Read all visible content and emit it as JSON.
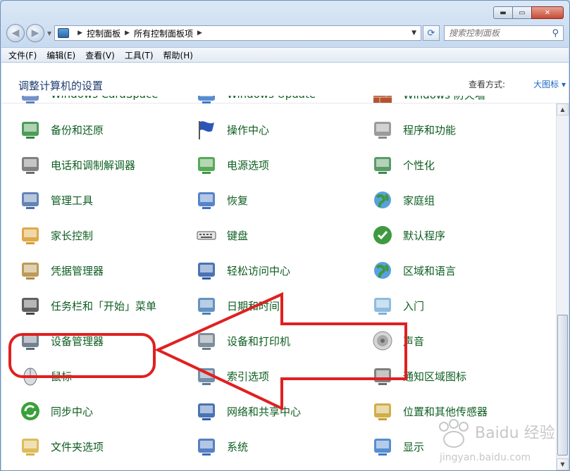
{
  "window": {
    "caption_buttons": {
      "minimize": "▬",
      "maximize": "▭",
      "close": "✕"
    }
  },
  "nav": {
    "back_icon": "◀",
    "forward_icon": "▶",
    "dropdown_icon": "▼",
    "breadcrumb": [
      "控制面板",
      "所有控制面板项"
    ],
    "refresh_icon": "⟳",
    "search_placeholder": "搜索控制面板",
    "search_icon": "⚲"
  },
  "menu": [
    "文件(F)",
    "编辑(E)",
    "查看(V)",
    "工具(T)",
    "帮助(H)"
  ],
  "header": {
    "title": "调整计算机的设置",
    "view_by_label": "查看方式:",
    "view_by_value": "大图标 ▾"
  },
  "items": [
    {
      "label": "Windows CardSpace",
      "icon": "cardspace-icon",
      "color": "#5b7fc0"
    },
    {
      "label": "Windows Update",
      "icon": "windows-update-icon",
      "color": "#3a78c8"
    },
    {
      "label": "Windows 防火墙",
      "icon": "firewall-icon",
      "color": "#b5532e"
    },
    {
      "label": "备份和还原",
      "icon": "backup-restore-icon",
      "color": "#2e8a3a"
    },
    {
      "label": "操作中心",
      "icon": "action-center-flag-icon",
      "color": "#2d55b8"
    },
    {
      "label": "程序和功能",
      "icon": "programs-features-icon",
      "color": "#8a8a8a"
    },
    {
      "label": "电话和调制解调器",
      "icon": "phone-modem-icon",
      "color": "#6b6b6b"
    },
    {
      "label": "电源选项",
      "icon": "power-options-icon",
      "color": "#3a9a3a"
    },
    {
      "label": "个性化",
      "icon": "personalization-icon",
      "color": "#3d8a4a"
    },
    {
      "label": "管理工具",
      "icon": "admin-tools-icon",
      "color": "#4a6ea8"
    },
    {
      "label": "恢复",
      "icon": "recovery-icon",
      "color": "#3a6fc0"
    },
    {
      "label": "家庭组",
      "icon": "homegroup-icon",
      "color": "#2f7fc9"
    },
    {
      "label": "家长控制",
      "icon": "parental-controls-icon",
      "color": "#d89a2a"
    },
    {
      "label": "键盘",
      "icon": "keyboard-icon",
      "color": "#555555"
    },
    {
      "label": "默认程序",
      "icon": "default-programs-icon",
      "color": "#3f9a3f"
    },
    {
      "label": "凭据管理器",
      "icon": "credential-manager-icon",
      "color": "#b0883a"
    },
    {
      "label": "轻松访问中心",
      "icon": "ease-of-access-icon",
      "color": "#2a5aa8"
    },
    {
      "label": "区域和语言",
      "icon": "region-language-icon",
      "color": "#2f8a4a"
    },
    {
      "label": "任务栏和「开始」菜单",
      "icon": "taskbar-start-menu-icon",
      "color": "#444444"
    },
    {
      "label": "日期和时间",
      "icon": "date-time-icon",
      "color": "#4a7fb8"
    },
    {
      "label": "入门",
      "icon": "getting-started-icon",
      "color": "#7ab0d8"
    },
    {
      "label": "设备管理器",
      "icon": "device-manager-icon",
      "color": "#5a6a7a"
    },
    {
      "label": "设备和打印机",
      "icon": "devices-printers-icon",
      "color": "#6a7a8a"
    },
    {
      "label": "声音",
      "icon": "sound-speaker-icon",
      "color": "#8a8a8a"
    },
    {
      "label": "鼠标",
      "icon": "mouse-icon",
      "color": "#8a8a8a"
    },
    {
      "label": "索引选项",
      "icon": "indexing-options-icon",
      "color": "#5a7a9a"
    },
    {
      "label": "通知区域图标",
      "icon": "notification-area-icon",
      "color": "#6a6a6a"
    },
    {
      "label": "同步中心",
      "icon": "sync-center-icon",
      "color": "#3aa03a"
    },
    {
      "label": "网络和共享中心",
      "icon": "network-sharing-icon",
      "color": "#2a5aa8"
    },
    {
      "label": "位置和其他传感器",
      "icon": "location-sensors-icon",
      "color": "#c8a02a"
    },
    {
      "label": "文件夹选项",
      "icon": "folder-options-icon",
      "color": "#d8b040"
    },
    {
      "label": "系统",
      "icon": "system-icon",
      "color": "#3a6ab8"
    },
    {
      "label": "显示",
      "icon": "display-icon",
      "color": "#3a7ac8"
    }
  ],
  "scrollbar": {
    "up_icon": "▲",
    "down_icon": "▼"
  },
  "annotation": {
    "color": "#e02020"
  },
  "watermark": {
    "text_top": "Baidu 经验",
    "text_bottom": "jingyan.baidu.com"
  }
}
